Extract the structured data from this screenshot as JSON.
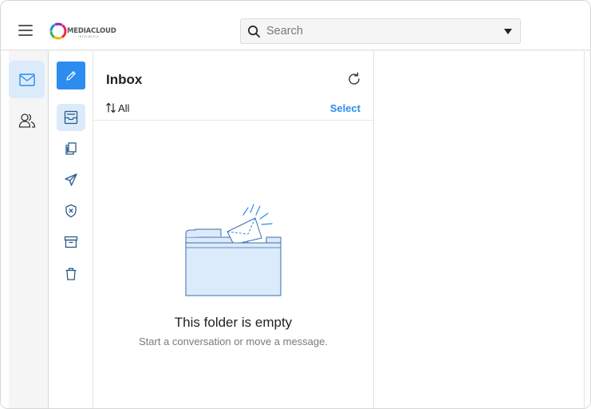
{
  "header": {
    "logo_text": "MEDIACLOUD",
    "logo_subtext": "INDONESIA",
    "search_placeholder": "Search"
  },
  "rail": {
    "items": [
      {
        "icon": "mail-icon",
        "active": true
      },
      {
        "icon": "contacts-icon",
        "active": false
      }
    ]
  },
  "folders": {
    "compose_icon": "pencil-icon",
    "items": [
      {
        "icon": "inbox-icon",
        "active": true
      },
      {
        "icon": "copy-icon"
      },
      {
        "icon": "send-icon"
      },
      {
        "icon": "shield-x-icon"
      },
      {
        "icon": "archive-icon"
      },
      {
        "icon": "trash-icon"
      }
    ]
  },
  "inbox": {
    "title": "Inbox",
    "sort_label": "All",
    "select_label": "Select",
    "empty_title": "This folder is empty",
    "empty_subtitle": "Start a conversation or move a message."
  },
  "colors": {
    "accent": "#2d8cf0",
    "active_bg": "#dcebfb",
    "illustration_fill": "#dcebfb",
    "illustration_stroke": "#3a6fa8"
  }
}
